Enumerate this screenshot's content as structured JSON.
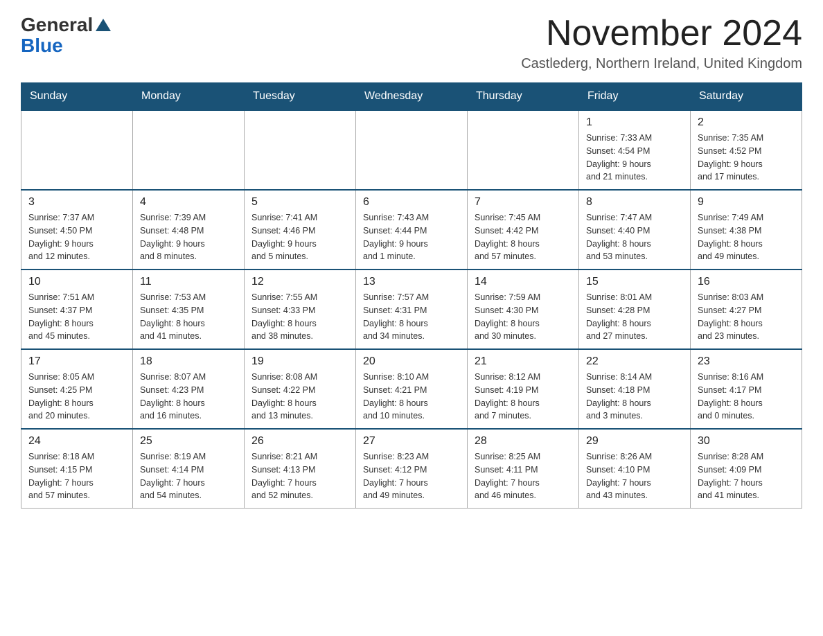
{
  "logo": {
    "general": "General",
    "blue": "Blue"
  },
  "header": {
    "title": "November 2024",
    "subtitle": "Castlederg, Northern Ireland, United Kingdom"
  },
  "weekdays": [
    "Sunday",
    "Monday",
    "Tuesday",
    "Wednesday",
    "Thursday",
    "Friday",
    "Saturday"
  ],
  "weeks": [
    {
      "days": [
        {
          "number": "",
          "info": ""
        },
        {
          "number": "",
          "info": ""
        },
        {
          "number": "",
          "info": ""
        },
        {
          "number": "",
          "info": ""
        },
        {
          "number": "",
          "info": ""
        },
        {
          "number": "1",
          "info": "Sunrise: 7:33 AM\nSunset: 4:54 PM\nDaylight: 9 hours\nand 21 minutes."
        },
        {
          "number": "2",
          "info": "Sunrise: 7:35 AM\nSunset: 4:52 PM\nDaylight: 9 hours\nand 17 minutes."
        }
      ]
    },
    {
      "days": [
        {
          "number": "3",
          "info": "Sunrise: 7:37 AM\nSunset: 4:50 PM\nDaylight: 9 hours\nand 12 minutes."
        },
        {
          "number": "4",
          "info": "Sunrise: 7:39 AM\nSunset: 4:48 PM\nDaylight: 9 hours\nand 8 minutes."
        },
        {
          "number": "5",
          "info": "Sunrise: 7:41 AM\nSunset: 4:46 PM\nDaylight: 9 hours\nand 5 minutes."
        },
        {
          "number": "6",
          "info": "Sunrise: 7:43 AM\nSunset: 4:44 PM\nDaylight: 9 hours\nand 1 minute."
        },
        {
          "number": "7",
          "info": "Sunrise: 7:45 AM\nSunset: 4:42 PM\nDaylight: 8 hours\nand 57 minutes."
        },
        {
          "number": "8",
          "info": "Sunrise: 7:47 AM\nSunset: 4:40 PM\nDaylight: 8 hours\nand 53 minutes."
        },
        {
          "number": "9",
          "info": "Sunrise: 7:49 AM\nSunset: 4:38 PM\nDaylight: 8 hours\nand 49 minutes."
        }
      ]
    },
    {
      "days": [
        {
          "number": "10",
          "info": "Sunrise: 7:51 AM\nSunset: 4:37 PM\nDaylight: 8 hours\nand 45 minutes."
        },
        {
          "number": "11",
          "info": "Sunrise: 7:53 AM\nSunset: 4:35 PM\nDaylight: 8 hours\nand 41 minutes."
        },
        {
          "number": "12",
          "info": "Sunrise: 7:55 AM\nSunset: 4:33 PM\nDaylight: 8 hours\nand 38 minutes."
        },
        {
          "number": "13",
          "info": "Sunrise: 7:57 AM\nSunset: 4:31 PM\nDaylight: 8 hours\nand 34 minutes."
        },
        {
          "number": "14",
          "info": "Sunrise: 7:59 AM\nSunset: 4:30 PM\nDaylight: 8 hours\nand 30 minutes."
        },
        {
          "number": "15",
          "info": "Sunrise: 8:01 AM\nSunset: 4:28 PM\nDaylight: 8 hours\nand 27 minutes."
        },
        {
          "number": "16",
          "info": "Sunrise: 8:03 AM\nSunset: 4:27 PM\nDaylight: 8 hours\nand 23 minutes."
        }
      ]
    },
    {
      "days": [
        {
          "number": "17",
          "info": "Sunrise: 8:05 AM\nSunset: 4:25 PM\nDaylight: 8 hours\nand 20 minutes."
        },
        {
          "number": "18",
          "info": "Sunrise: 8:07 AM\nSunset: 4:23 PM\nDaylight: 8 hours\nand 16 minutes."
        },
        {
          "number": "19",
          "info": "Sunrise: 8:08 AM\nSunset: 4:22 PM\nDaylight: 8 hours\nand 13 minutes."
        },
        {
          "number": "20",
          "info": "Sunrise: 8:10 AM\nSunset: 4:21 PM\nDaylight: 8 hours\nand 10 minutes."
        },
        {
          "number": "21",
          "info": "Sunrise: 8:12 AM\nSunset: 4:19 PM\nDaylight: 8 hours\nand 7 minutes."
        },
        {
          "number": "22",
          "info": "Sunrise: 8:14 AM\nSunset: 4:18 PM\nDaylight: 8 hours\nand 3 minutes."
        },
        {
          "number": "23",
          "info": "Sunrise: 8:16 AM\nSunset: 4:17 PM\nDaylight: 8 hours\nand 0 minutes."
        }
      ]
    },
    {
      "days": [
        {
          "number": "24",
          "info": "Sunrise: 8:18 AM\nSunset: 4:15 PM\nDaylight: 7 hours\nand 57 minutes."
        },
        {
          "number": "25",
          "info": "Sunrise: 8:19 AM\nSunset: 4:14 PM\nDaylight: 7 hours\nand 54 minutes."
        },
        {
          "number": "26",
          "info": "Sunrise: 8:21 AM\nSunset: 4:13 PM\nDaylight: 7 hours\nand 52 minutes."
        },
        {
          "number": "27",
          "info": "Sunrise: 8:23 AM\nSunset: 4:12 PM\nDaylight: 7 hours\nand 49 minutes."
        },
        {
          "number": "28",
          "info": "Sunrise: 8:25 AM\nSunset: 4:11 PM\nDaylight: 7 hours\nand 46 minutes."
        },
        {
          "number": "29",
          "info": "Sunrise: 8:26 AM\nSunset: 4:10 PM\nDaylight: 7 hours\nand 43 minutes."
        },
        {
          "number": "30",
          "info": "Sunrise: 8:28 AM\nSunset: 4:09 PM\nDaylight: 7 hours\nand 41 minutes."
        }
      ]
    }
  ]
}
